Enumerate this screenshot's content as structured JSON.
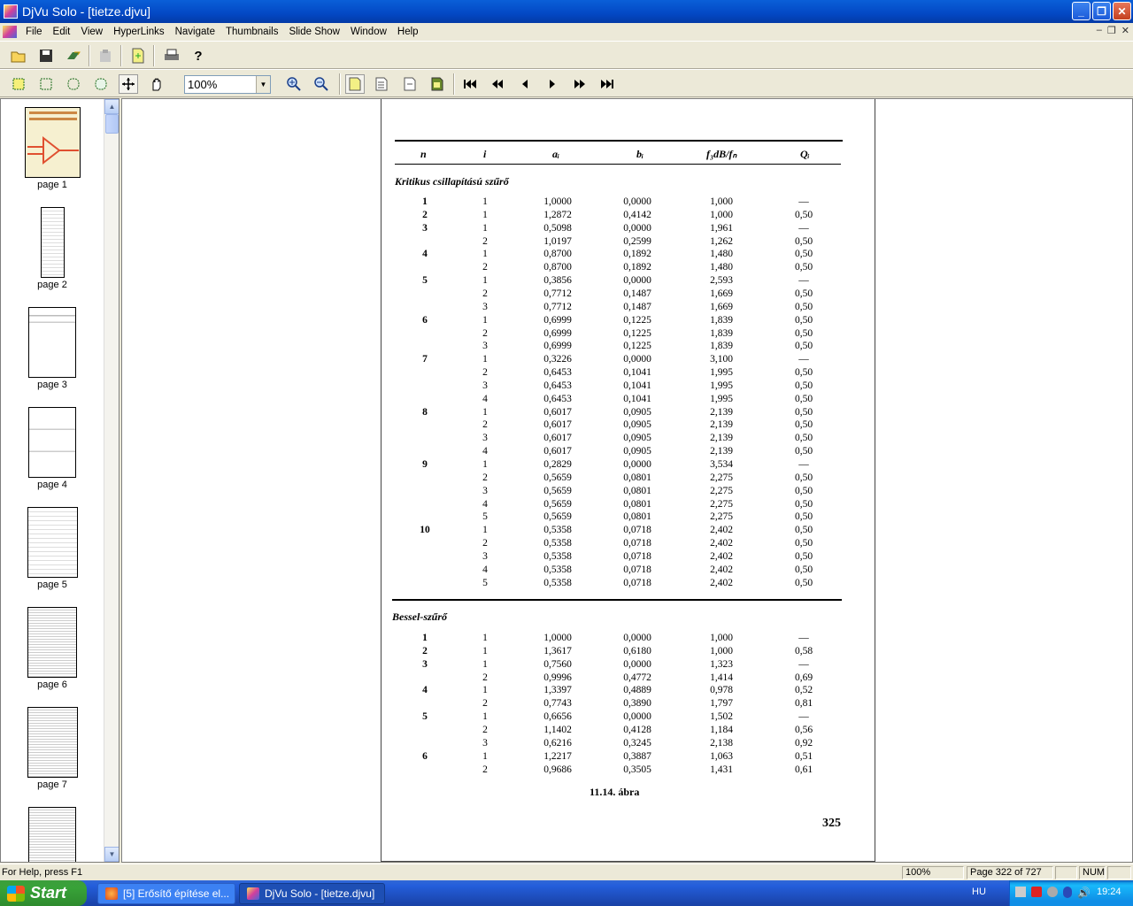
{
  "window": {
    "title": "DjVu Solo - [tietze.djvu]"
  },
  "menu": [
    "File",
    "Edit",
    "View",
    "HyperLinks",
    "Navigate",
    "Thumbnails",
    "Slide Show",
    "Window",
    "Help"
  ],
  "toolbar": {
    "zoom_value": "100%"
  },
  "thumbnails": [
    {
      "label": "page 1"
    },
    {
      "label": "page 2"
    },
    {
      "label": "page 3"
    },
    {
      "label": "page 4"
    },
    {
      "label": "page 5"
    },
    {
      "label": "page 6"
    },
    {
      "label": "page 7"
    }
  ],
  "document": {
    "headers": {
      "n": "n",
      "i": "i",
      "a": "aᵢ",
      "b": "bᵢ",
      "f": "f₃dB/fₙ",
      "q": "Qᵢ"
    },
    "sections": [
      {
        "title": "Kritikus csillapítású szűrő",
        "rows": [
          {
            "n": "1",
            "i": "1",
            "a": "1,0000",
            "b": "0,0000",
            "f": "1,000",
            "q": "—"
          },
          {
            "n": "2",
            "i": "1",
            "a": "1,2872",
            "b": "0,4142",
            "f": "1,000",
            "q": "0,50"
          },
          {
            "n": "3",
            "i": "1",
            "a": "0,5098",
            "b": "0,0000",
            "f": "1,961",
            "q": "—"
          },
          {
            "n": "",
            "i": "2",
            "a": "1,0197",
            "b": "0,2599",
            "f": "1,262",
            "q": "0,50"
          },
          {
            "n": "4",
            "i": "1",
            "a": "0,8700",
            "b": "0,1892",
            "f": "1,480",
            "q": "0,50"
          },
          {
            "n": "",
            "i": "2",
            "a": "0,8700",
            "b": "0,1892",
            "f": "1,480",
            "q": "0,50"
          },
          {
            "n": "5",
            "i": "1",
            "a": "0,3856",
            "b": "0,0000",
            "f": "2,593",
            "q": "—"
          },
          {
            "n": "",
            "i": "2",
            "a": "0,7712",
            "b": "0,1487",
            "f": "1,669",
            "q": "0,50"
          },
          {
            "n": "",
            "i": "3",
            "a": "0,7712",
            "b": "0,1487",
            "f": "1,669",
            "q": "0,50"
          },
          {
            "n": "6",
            "i": "1",
            "a": "0,6999",
            "b": "0,1225",
            "f": "1,839",
            "q": "0,50"
          },
          {
            "n": "",
            "i": "2",
            "a": "0,6999",
            "b": "0,1225",
            "f": "1,839",
            "q": "0,50"
          },
          {
            "n": "",
            "i": "3",
            "a": "0,6999",
            "b": "0,1225",
            "f": "1,839",
            "q": "0,50"
          },
          {
            "n": "7",
            "i": "1",
            "a": "0,3226",
            "b": "0,0000",
            "f": "3,100",
            "q": "—"
          },
          {
            "n": "",
            "i": "2",
            "a": "0,6453",
            "b": "0,1041",
            "f": "1,995",
            "q": "0,50"
          },
          {
            "n": "",
            "i": "3",
            "a": "0,6453",
            "b": "0,1041",
            "f": "1,995",
            "q": "0,50"
          },
          {
            "n": "",
            "i": "4",
            "a": "0,6453",
            "b": "0,1041",
            "f": "1,995",
            "q": "0,50"
          },
          {
            "n": "8",
            "i": "1",
            "a": "0,6017",
            "b": "0,0905",
            "f": "2,139",
            "q": "0,50"
          },
          {
            "n": "",
            "i": "2",
            "a": "0,6017",
            "b": "0,0905",
            "f": "2,139",
            "q": "0,50"
          },
          {
            "n": "",
            "i": "3",
            "a": "0,6017",
            "b": "0,0905",
            "f": "2,139",
            "q": "0,50"
          },
          {
            "n": "",
            "i": "4",
            "a": "0,6017",
            "b": "0,0905",
            "f": "2,139",
            "q": "0,50"
          },
          {
            "n": "9",
            "i": "1",
            "a": "0,2829",
            "b": "0,0000",
            "f": "3,534",
            "q": "—"
          },
          {
            "n": "",
            "i": "2",
            "a": "0,5659",
            "b": "0,0801",
            "f": "2,275",
            "q": "0,50"
          },
          {
            "n": "",
            "i": "3",
            "a": "0,5659",
            "b": "0,0801",
            "f": "2,275",
            "q": "0,50"
          },
          {
            "n": "",
            "i": "4",
            "a": "0,5659",
            "b": "0,0801",
            "f": "2,275",
            "q": "0,50"
          },
          {
            "n": "",
            "i": "5",
            "a": "0,5659",
            "b": "0,0801",
            "f": "2,275",
            "q": "0,50"
          },
          {
            "n": "10",
            "i": "1",
            "a": "0,5358",
            "b": "0,0718",
            "f": "2,402",
            "q": "0,50"
          },
          {
            "n": "",
            "i": "2",
            "a": "0,5358",
            "b": "0,0718",
            "f": "2,402",
            "q": "0,50"
          },
          {
            "n": "",
            "i": "3",
            "a": "0,5358",
            "b": "0,0718",
            "f": "2,402",
            "q": "0,50"
          },
          {
            "n": "",
            "i": "4",
            "a": "0,5358",
            "b": "0,0718",
            "f": "2,402",
            "q": "0,50"
          },
          {
            "n": "",
            "i": "5",
            "a": "0,5358",
            "b": "0,0718",
            "f": "2,402",
            "q": "0,50"
          }
        ]
      },
      {
        "title": "Bessel-szűrő",
        "rows": [
          {
            "n": "1",
            "i": "1",
            "a": "1,0000",
            "b": "0,0000",
            "f": "1,000",
            "q": "—"
          },
          {
            "n": "2",
            "i": "1",
            "a": "1,3617",
            "b": "0,6180",
            "f": "1,000",
            "q": "0,58"
          },
          {
            "n": "3",
            "i": "1",
            "a": "0,7560",
            "b": "0,0000",
            "f": "1,323",
            "q": "—"
          },
          {
            "n": "",
            "i": "2",
            "a": "0,9996",
            "b": "0,4772",
            "f": "1,414",
            "q": "0,69"
          },
          {
            "n": "4",
            "i": "1",
            "a": "1,3397",
            "b": "0,4889",
            "f": "0,978",
            "q": "0,52"
          },
          {
            "n": "",
            "i": "2",
            "a": "0,7743",
            "b": "0,3890",
            "f": "1,797",
            "q": "0,81"
          },
          {
            "n": "5",
            "i": "1",
            "a": "0,6656",
            "b": "0,0000",
            "f": "1,502",
            "q": "—"
          },
          {
            "n": "",
            "i": "2",
            "a": "1,1402",
            "b": "0,4128",
            "f": "1,184",
            "q": "0,56"
          },
          {
            "n": "",
            "i": "3",
            "a": "0,6216",
            "b": "0,3245",
            "f": "2,138",
            "q": "0,92"
          },
          {
            "n": "6",
            "i": "1",
            "a": "1,2217",
            "b": "0,3887",
            "f": "1,063",
            "q": "0,51"
          },
          {
            "n": "",
            "i": "2",
            "a": "0,9686",
            "b": "0,3505",
            "f": "1,431",
            "q": "0,61"
          }
        ]
      }
    ],
    "caption": "11.14. ábra",
    "page_number": "325"
  },
  "status": {
    "help": "For Help, press F1",
    "zoom": "100%",
    "page": "Page 322 of 727",
    "num": "NUM"
  },
  "taskbar": {
    "start": "Start",
    "tasks": [
      "[5] Erősítő építése el...",
      "DjVu Solo - [tietze.djvu]"
    ],
    "lang": "HU",
    "clock": "19:24"
  }
}
